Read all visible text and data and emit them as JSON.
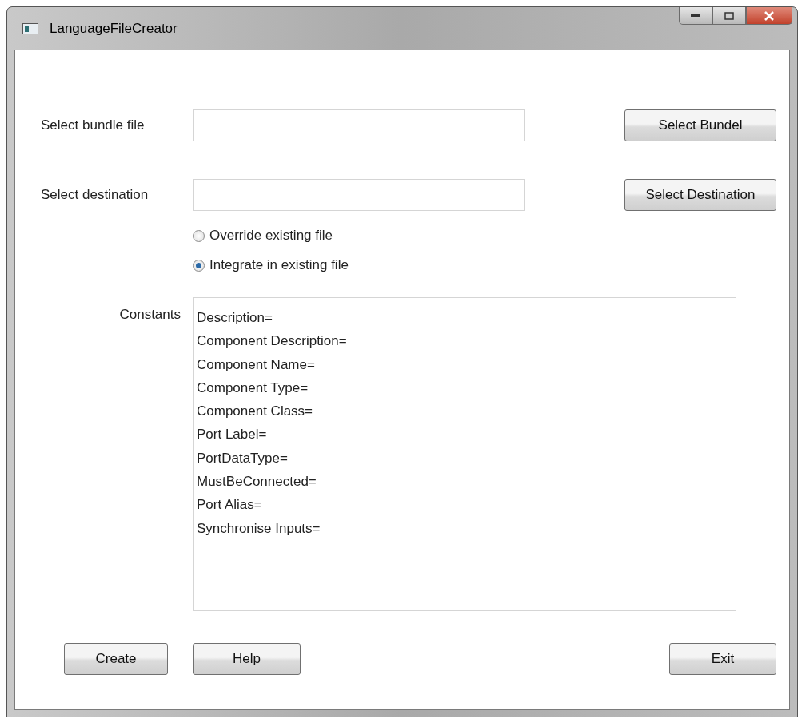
{
  "window": {
    "title": "LanguageFileCreator"
  },
  "fields": [
    {
      "label": "Select bundle file",
      "button": "Select Bundel"
    },
    {
      "label": "Select destination",
      "button": "Select Destination"
    }
  ],
  "radios": [
    {
      "label": "Override existing file",
      "selected": false
    },
    {
      "label": "Integrate in existing file",
      "selected": true
    }
  ],
  "constants": {
    "label": "Constants",
    "lines": [
      "Description=",
      "Component Description=",
      "Component Name=",
      "Component Type=",
      "Component Class=",
      "Port Label=",
      "PortDataType=",
      "MustBeConnected=",
      "Port Alias=",
      "Synchronise Inputs="
    ]
  },
  "buttons": [
    "Create",
    "Help",
    "Exit"
  ]
}
